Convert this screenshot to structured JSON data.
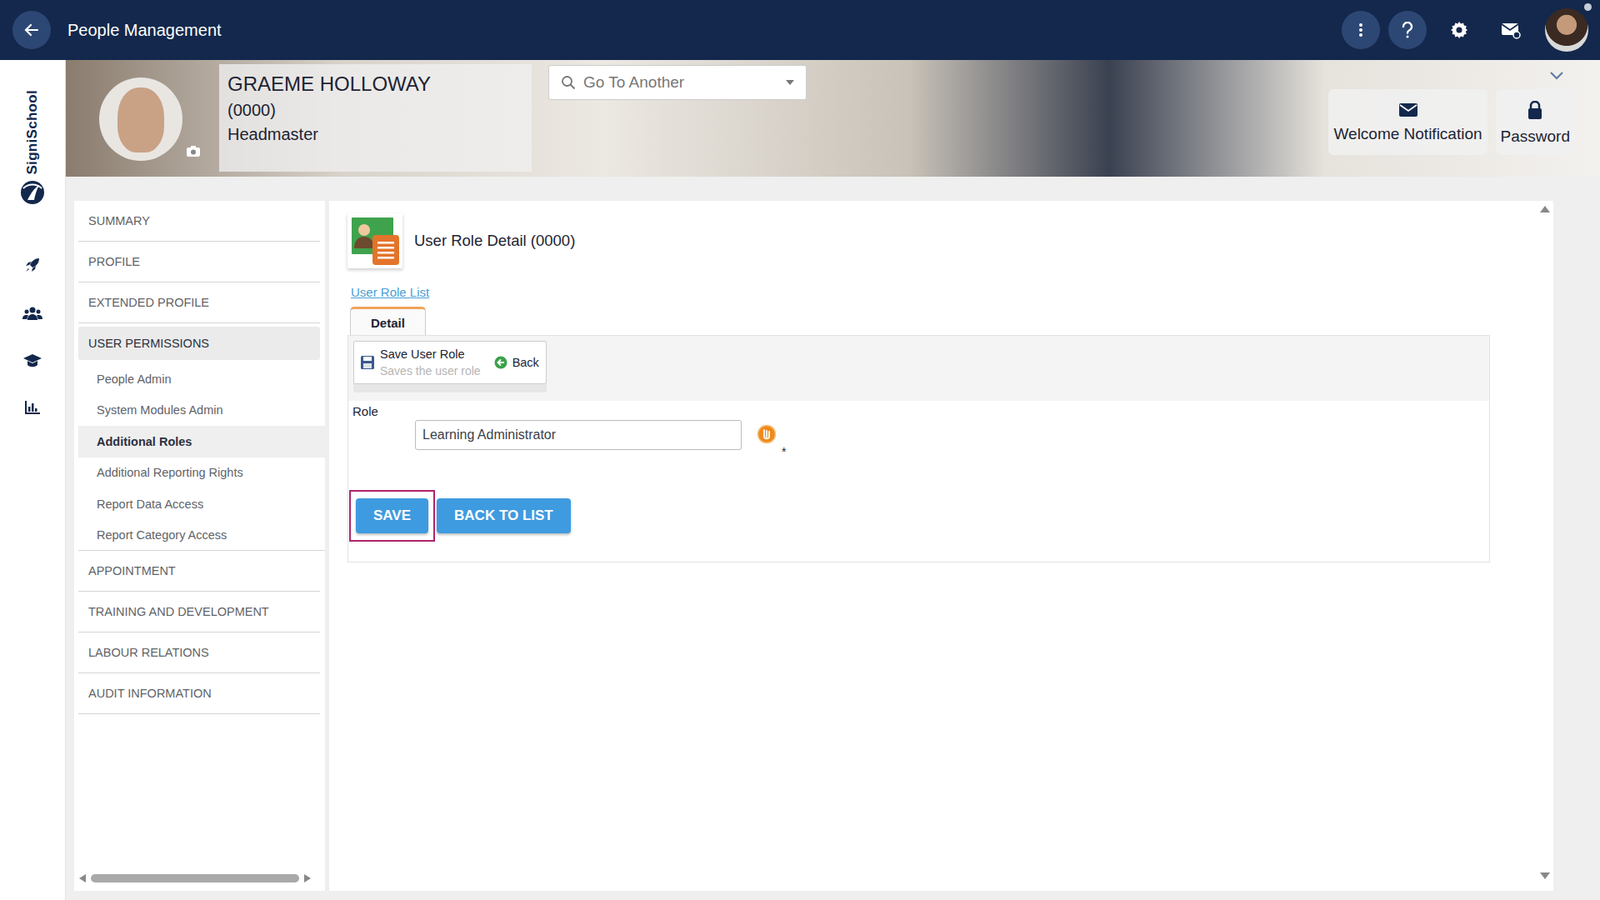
{
  "topbar": {
    "title": "People Management"
  },
  "logo": {
    "text": "SigniSchool"
  },
  "person": {
    "name": "GRAEME HOLLOWAY",
    "code": "(0000)",
    "role": "Headmaster"
  },
  "search": {
    "placeholder": "Go To Another"
  },
  "header_buttons": [
    "Welcome Notification",
    "Password"
  ],
  "menu": [
    {
      "label": "SUMMARY",
      "kind": "section",
      "selected": false
    },
    {
      "label": "PROFILE",
      "kind": "section",
      "selected": false
    },
    {
      "label": "EXTENDED PROFILE",
      "kind": "section",
      "selected": false
    },
    {
      "label": "USER PERMISSIONS",
      "kind": "section",
      "selected": true
    },
    {
      "label": "People Admin",
      "kind": "sub",
      "selected": false
    },
    {
      "label": "System Modules Admin",
      "kind": "sub",
      "selected": false
    },
    {
      "label": "Additional Roles",
      "kind": "sub",
      "selected": true
    },
    {
      "label": "Additional Reporting Rights",
      "kind": "sub",
      "selected": false
    },
    {
      "label": "Report Data Access",
      "kind": "sub",
      "selected": false
    },
    {
      "label": "Report Category Access",
      "kind": "sub",
      "selected": false
    },
    {
      "label": "APPOINTMENT",
      "kind": "section",
      "selected": false
    },
    {
      "label": "TRAINING AND DEVELOPMENT",
      "kind": "section",
      "selected": false
    },
    {
      "label": "LABOUR RELATIONS",
      "kind": "section",
      "selected": false
    },
    {
      "label": "AUDIT INFORMATION",
      "kind": "section",
      "selected": false
    }
  ],
  "page": {
    "title": "User Role Detail (0000)",
    "breadcrumb": "User Role List"
  },
  "tabs": [
    {
      "label": "Detail",
      "selected": true
    }
  ],
  "toolbar": {
    "save_label": "Save User Role",
    "save_hint": "Saves the user role",
    "back_label": "Back"
  },
  "form": {
    "label": "Role",
    "value": "Learning Administrator",
    "required_mark": "*"
  },
  "buttons": [
    {
      "label": "SAVE",
      "highlighted": true
    },
    {
      "label": "BACK TO LIST",
      "highlighted": false
    }
  ]
}
